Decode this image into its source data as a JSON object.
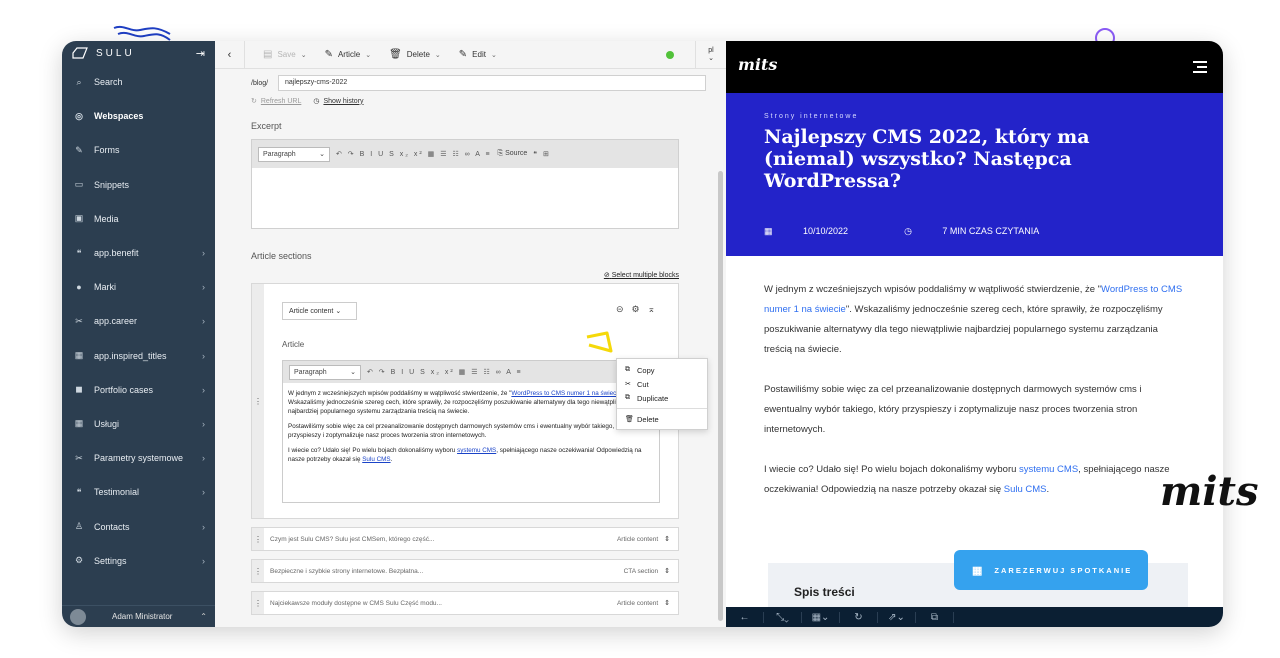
{
  "sidebar": {
    "brand": "SULU",
    "items": [
      {
        "icon": "search-icon",
        "glyph": "⌕",
        "label": "Search",
        "chev": ""
      },
      {
        "icon": "globe-icon",
        "glyph": "◎",
        "label": "Webspaces",
        "chev": ""
      },
      {
        "icon": "pen-icon",
        "glyph": "✎",
        "label": "Forms",
        "chev": ""
      },
      {
        "icon": "snippet-icon",
        "glyph": "▭",
        "label": "Snippets",
        "chev": ""
      },
      {
        "icon": "image-icon",
        "glyph": "▣",
        "label": "Media",
        "chev": ""
      },
      {
        "icon": "quote-icon",
        "glyph": "❝",
        "label": "app.benefit",
        "chev": "›"
      },
      {
        "icon": "circle-icon",
        "glyph": "●",
        "label": "Marki",
        "chev": "›"
      },
      {
        "icon": "wrench-icon",
        "glyph": "✂",
        "label": "app.career",
        "chev": "›"
      },
      {
        "icon": "calendar-icon",
        "glyph": "▦",
        "label": "app.inspired_titles",
        "chev": "›"
      },
      {
        "icon": "briefcase-icon",
        "glyph": "◼",
        "label": "Portfolio cases",
        "chev": "›"
      },
      {
        "icon": "calendar-icon",
        "glyph": "▦",
        "label": "Usługi",
        "chev": "›"
      },
      {
        "icon": "wrench-icon",
        "glyph": "✂",
        "label": "Parametry systemowe",
        "chev": "›"
      },
      {
        "icon": "quote-icon",
        "glyph": "❝",
        "label": "Testimonial",
        "chev": "›"
      },
      {
        "icon": "user-icon",
        "glyph": "♙",
        "label": "Contacts",
        "chev": "›"
      },
      {
        "icon": "gear-icon",
        "glyph": "⚙",
        "label": "Settings",
        "chev": "›"
      }
    ],
    "user": "Adam Ministrator"
  },
  "toolbar": {
    "save": "Save",
    "article": "Article",
    "delete": "Delete",
    "edit": "Edit",
    "locale": "pl"
  },
  "url": {
    "prefix": "/blog/",
    "value": "najlepszy-cms-2022",
    "refresh": "Refresh URL",
    "history": "Show history"
  },
  "excerpt": {
    "label": "Excerpt",
    "paragraph": "Paragraph",
    "source": "Source"
  },
  "sections": {
    "label": "Article sections",
    "select_multiple": "Select multiple blocks",
    "block_type": "Article content",
    "article_label": "Article",
    "paragraph": "Paragraph",
    "p1_pre": "W jednym z wcześniejszych wpisów poddaliśmy w wątpliwość stwierdzenie, że \"",
    "p1_link": "WordPress to CMS numer 1 na świecie",
    "p1_post": "\". Wskazaliśmy jednocześnie szereg cech, które sprawiły, że rozpoczęliśmy poszukiwanie alternatywy dla tego niewątpliwie najbardziej popularnego systemu zarządzania treścią na świecie.",
    "p2": "Postawiliśmy sobie więc za cel przeanalizowanie dostępnych darmowych systemów cms i ewentualny wybór takiego, który przyspieszy i zoptymalizuje nasz proces tworzenia stron internetowych.",
    "p3_pre": "I wiecie co? Udało się! Po wielu bojach dokonaliśmy wyboru ",
    "p3_link": "systemu CMS",
    "p3_mid": ", spełniającego nasze oczekiwania! Odpowiedzią na nasze potrzeby okazał się ",
    "p3_link2": "Sulu CMS",
    "p3_end": ".",
    "collapsed": [
      {
        "text": "Czym jest Sulu CMS? Sulu jest CMSem, którego część...",
        "type": "Article content"
      },
      {
        "text": "Bezpieczne i szybkie strony internetowe. Bezpłatna...",
        "type": "CTA section"
      },
      {
        "text": "Najciekawsze moduły dostępne w CMS Sulu Część modu...",
        "type": "Article content"
      }
    ]
  },
  "context_menu": {
    "copy": "Copy",
    "cut": "Cut",
    "duplicate": "Duplicate",
    "delete": "Delete"
  },
  "preview": {
    "logo": "mits",
    "category": "Strony internetowe",
    "title": "Najlepszy CMS 2022, który ma (niemal) wszystko? Następca WordPressa?",
    "date": "10/10/2022",
    "read_time": "7 MIN CZAS CZYTANIA",
    "p1_pre": "W jednym z wcześniejszych wpisów poddaliśmy w wątpliwość stwierdzenie, że \"",
    "p1_link": "WordPress to CMS numer 1 na świecie",
    "p1_post": "\". Wskazaliśmy jednocześnie szereg cech, które sprawiły, że rozpoczęliśmy poszukiwanie alternatywy dla tego niewątpliwie najbardziej popularnego systemu zarządzania treścią na świecie.",
    "p2": "Postawiliśmy sobie więc za cel przeanalizowanie dostępnych darmowych systemów cms i ewentualny wybór takiego, który przyspieszy i zoptymalizuje nasz proces tworzenia stron internetowych.",
    "p3_pre": "I wiecie co? Udało się! Po wielu bojach dokonaliśmy wyboru ",
    "p3_link": "systemu CMS",
    "p3_post": ", spełniającego nasze oczekiwania! Odpowiedzią na nasze potrzeby okazał się ",
    "p3_link2": "Sulu CMS",
    "p3_end": ".",
    "toc": "Spis treści",
    "book": "ZAREZERWUJ SPOTKANIE"
  },
  "colors": {
    "sidebar": "#2c3e50",
    "hero": "#2323c9",
    "accent": "#35a2ee",
    "status": "#52c23a"
  }
}
